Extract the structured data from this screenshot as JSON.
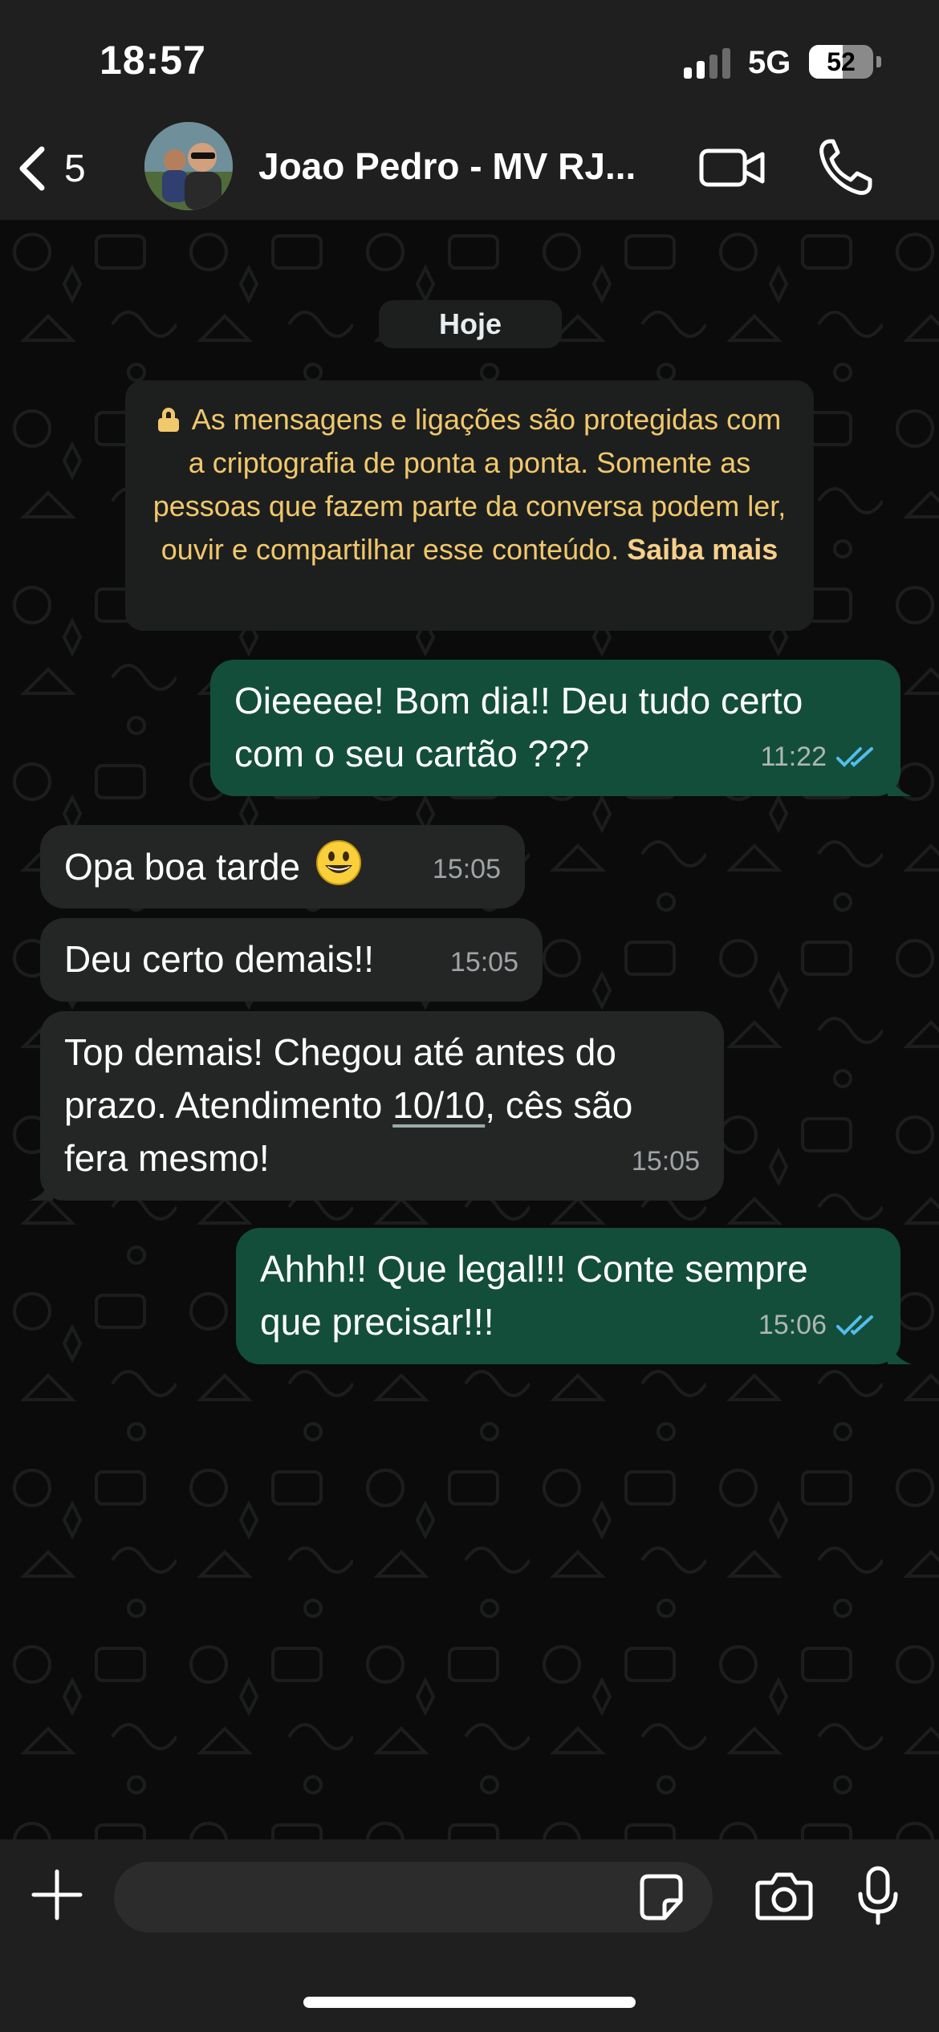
{
  "status_bar": {
    "time": "18:57",
    "network": "5G",
    "battery": "52",
    "battery_level_pct": 52
  },
  "header": {
    "back_count": "5",
    "contact_name": "Joao Pedro - MV RJ...",
    "icons": [
      "chevron-left-icon",
      "video-icon",
      "phone-icon"
    ]
  },
  "chat": {
    "date_label": "Hoje",
    "encryption": {
      "text": "As mensagens e ligações são protegidas com a criptografia de ponta a ponta. Somente as pessoas que fazem parte da conversa podem ler, ouvir e compartilhar esse conteúdo.",
      "link": "Saiba mais"
    },
    "messages": [
      {
        "direction": "out",
        "text": "Oieeeee! Bom dia!!  Deu tudo certo com o seu cartão ???",
        "time": "11:22",
        "status": "read"
      },
      {
        "direction": "in",
        "text": "Opa boa tarde",
        "time": "15:05",
        "emoji": "smiley-emoji"
      },
      {
        "direction": "in",
        "text": "Deu certo demais!!",
        "time": "15:05"
      },
      {
        "direction": "in",
        "text_before": "Top demais! Chegou até antes do prazo. Atendimento ",
        "text_link": "10/10",
        "text_after": ", cês são fera mesmo!",
        "time": "15:05"
      },
      {
        "direction": "out",
        "text": "Ahhh!! Que legal!!! Conte sempre que precisar!!!",
        "time": "15:06",
        "status": "read"
      }
    ]
  },
  "input_bar": {
    "placeholder": "",
    "icons": [
      "plus-icon",
      "sticker-icon",
      "camera-icon",
      "microphone-icon"
    ]
  },
  "colors": {
    "outgoing_bubble": "#134e3a",
    "incoming_bubble": "#242626",
    "read_ticks": "#53bdeb",
    "encryption_text": "#f1c86b"
  }
}
